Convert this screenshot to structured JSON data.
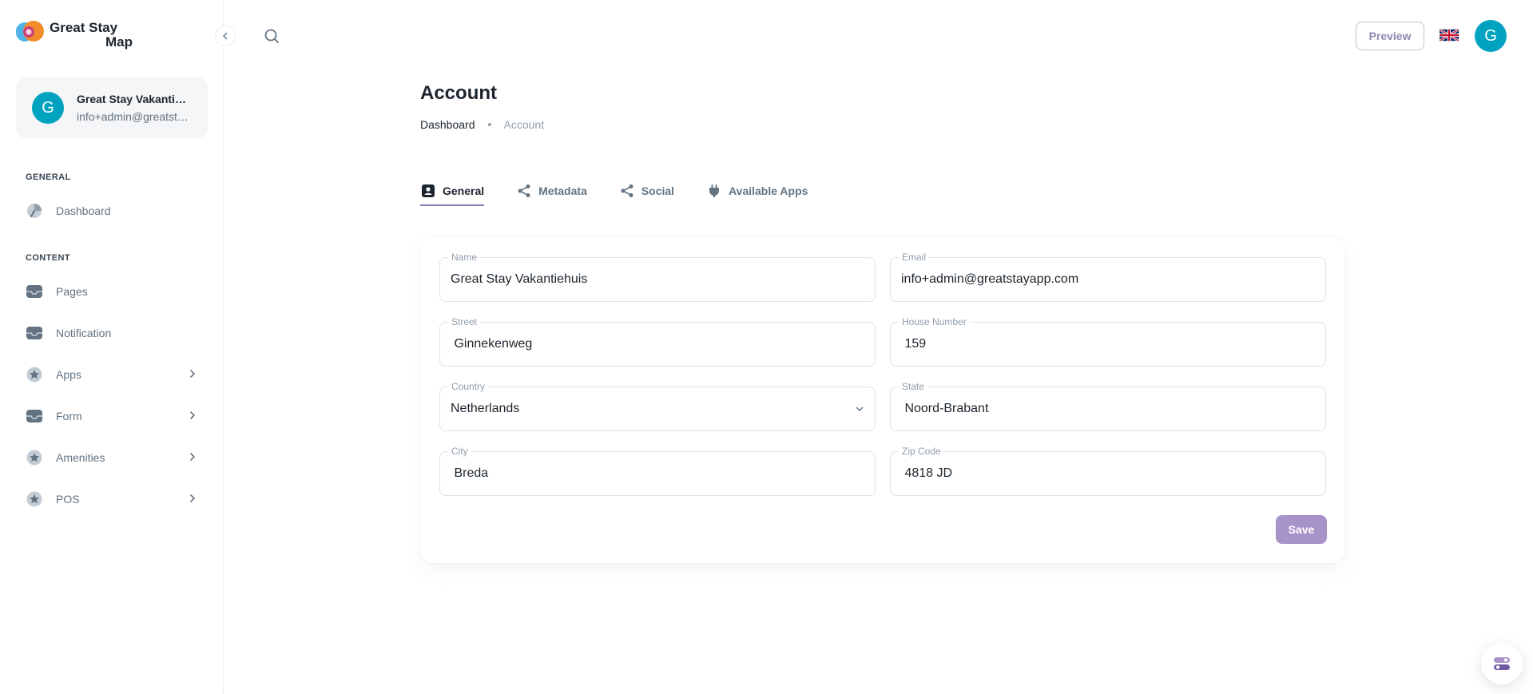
{
  "brand": {
    "name_line1": "Great Stay",
    "name_line2": "Map"
  },
  "account": {
    "avatar_letter": "G",
    "name": "Great Stay Vakantiehuis",
    "email": "info+admin@greatstayapp.com"
  },
  "sidebar": {
    "sections": [
      {
        "title": "GENERAL"
      },
      {
        "title": "CONTENT"
      }
    ],
    "items": [
      {
        "label": "Dashboard",
        "icon": "dashboard-icon",
        "has_children": false
      },
      {
        "label": "Pages",
        "icon": "inbox-icon",
        "has_children": false
      },
      {
        "label": "Notification",
        "icon": "inbox-icon",
        "has_children": false
      },
      {
        "label": "Apps",
        "icon": "star-icon",
        "has_children": true
      },
      {
        "label": "Form",
        "icon": "inbox-icon",
        "has_children": true
      },
      {
        "label": "Amenities",
        "icon": "star-icon",
        "has_children": true
      },
      {
        "label": "POS",
        "icon": "star-icon",
        "has_children": true
      }
    ]
  },
  "header": {
    "preview_label": "Preview",
    "language_flag": "uk-flag-icon",
    "avatar_letter": "G"
  },
  "page": {
    "title": "Account",
    "breadcrumb": {
      "parent": "Dashboard",
      "current": "Account"
    },
    "tabs": [
      {
        "label": "General",
        "icon": "contact-card-icon",
        "active": true
      },
      {
        "label": "Metadata",
        "icon": "share-icon",
        "active": false
      },
      {
        "label": "Social",
        "icon": "share-icon",
        "active": false
      },
      {
        "label": "Available Apps",
        "icon": "plug-icon",
        "active": false
      }
    ]
  },
  "form": {
    "name": {
      "label": "Name",
      "value": "Great Stay Vakantiehuis"
    },
    "email": {
      "label": "Email",
      "value": "info+admin@greatstayapp.com"
    },
    "street": {
      "label": "Street",
      "value": " Ginnekenweg"
    },
    "house_number": {
      "label": "House Number",
      "value": " 159"
    },
    "country": {
      "label": "Country",
      "value": "Netherlands"
    },
    "state": {
      "label": "State",
      "value": " Noord-Brabant"
    },
    "city": {
      "label": "City",
      "value": " Breda"
    },
    "zip_code": {
      "label": "Zip Code",
      "value": " 4818 JD"
    },
    "save_label": "Save"
  },
  "colors": {
    "accent": "#8e7bb8",
    "save_button": "#a893c8",
    "avatar": "#00a3bf"
  }
}
